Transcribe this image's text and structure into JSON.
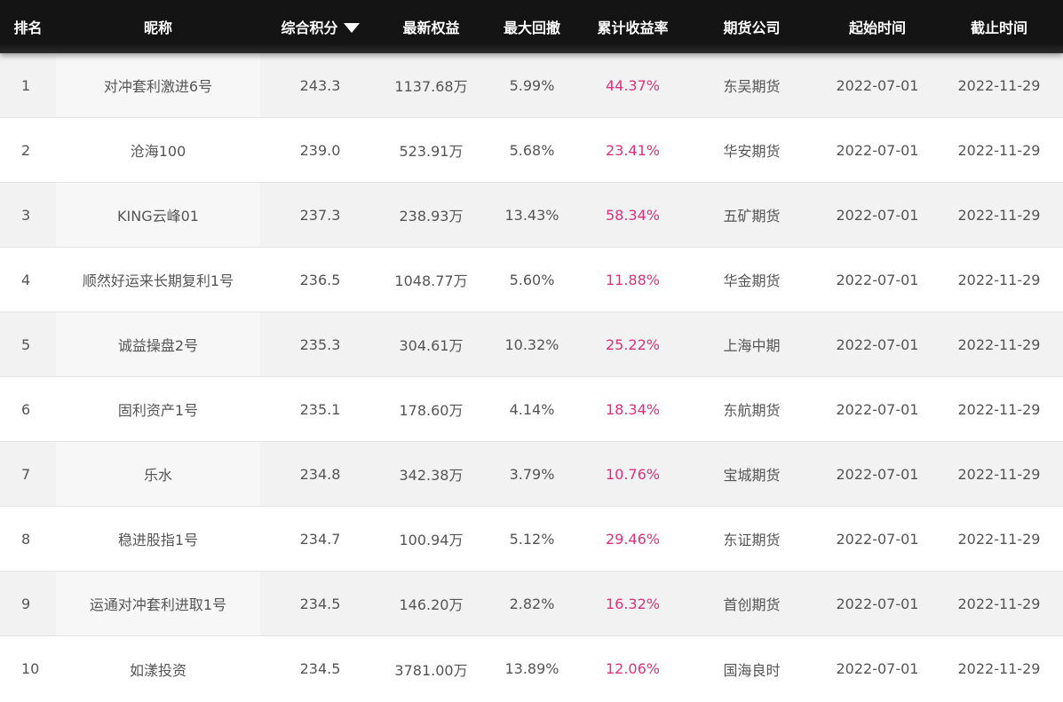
{
  "table": {
    "headers": {
      "rank": "排名",
      "nickname": "昵称",
      "score": "综合积分",
      "equity": "最新权益",
      "drawdown": "最大回撤",
      "return": "累计收益率",
      "broker": "期货公司",
      "start": "起始时间",
      "end": "截止时间"
    },
    "sort_icon": "sort-desc-triangle-icon",
    "rows": [
      {
        "rank": "1",
        "nickname": "对冲套利激进6号",
        "score": "243.3",
        "equity": "1137.68万",
        "drawdown": "5.99%",
        "return": "44.37%",
        "broker": "东吴期货",
        "start": "2022-07-01",
        "end": "2022-11-29"
      },
      {
        "rank": "2",
        "nickname": "沧海100",
        "score": "239.0",
        "equity": "523.91万",
        "drawdown": "5.68%",
        "return": "23.41%",
        "broker": "华安期货",
        "start": "2022-07-01",
        "end": "2022-11-29"
      },
      {
        "rank": "3",
        "nickname": "KING云峰01",
        "score": "237.3",
        "equity": "238.93万",
        "drawdown": "13.43%",
        "return": "58.34%",
        "broker": "五矿期货",
        "start": "2022-07-01",
        "end": "2022-11-29"
      },
      {
        "rank": "4",
        "nickname": "顺然好运来长期复利1号",
        "score": "236.5",
        "equity": "1048.77万",
        "drawdown": "5.60%",
        "return": "11.88%",
        "broker": "华金期货",
        "start": "2022-07-01",
        "end": "2022-11-29"
      },
      {
        "rank": "5",
        "nickname": "诚益操盘2号",
        "score": "235.3",
        "equity": "304.61万",
        "drawdown": "10.32%",
        "return": "25.22%",
        "broker": "上海中期",
        "start": "2022-07-01",
        "end": "2022-11-29"
      },
      {
        "rank": "6",
        "nickname": "固利资产1号",
        "score": "235.1",
        "equity": "178.60万",
        "drawdown": "4.14%",
        "return": "18.34%",
        "broker": "东航期货",
        "start": "2022-07-01",
        "end": "2022-11-29"
      },
      {
        "rank": "7",
        "nickname": "乐水",
        "score": "234.8",
        "equity": "342.38万",
        "drawdown": "3.79%",
        "return": "10.76%",
        "broker": "宝城期货",
        "start": "2022-07-01",
        "end": "2022-11-29"
      },
      {
        "rank": "8",
        "nickname": "稳进股指1号",
        "score": "234.7",
        "equity": "100.94万",
        "drawdown": "5.12%",
        "return": "29.46%",
        "broker": "东证期货",
        "start": "2022-07-01",
        "end": "2022-11-29"
      },
      {
        "rank": "9",
        "nickname": "运通对冲套利进取1号",
        "score": "234.5",
        "equity": "146.20万",
        "drawdown": "2.82%",
        "return": "16.32%",
        "broker": "首创期货",
        "start": "2022-07-01",
        "end": "2022-11-29"
      },
      {
        "rank": "10",
        "nickname": "如漾投资",
        "score": "234.5",
        "equity": "3781.00万",
        "drawdown": "13.89%",
        "return": "12.06%",
        "broker": "国海良时",
        "start": "2022-07-01",
        "end": "2022-11-29"
      }
    ]
  },
  "colors": {
    "header_bg": "#141414",
    "header_text": "#ffffff",
    "row_odd": "#f2f2f2",
    "row_even": "#ffffff",
    "text": "#555555",
    "return_accent": "#e0307c"
  }
}
